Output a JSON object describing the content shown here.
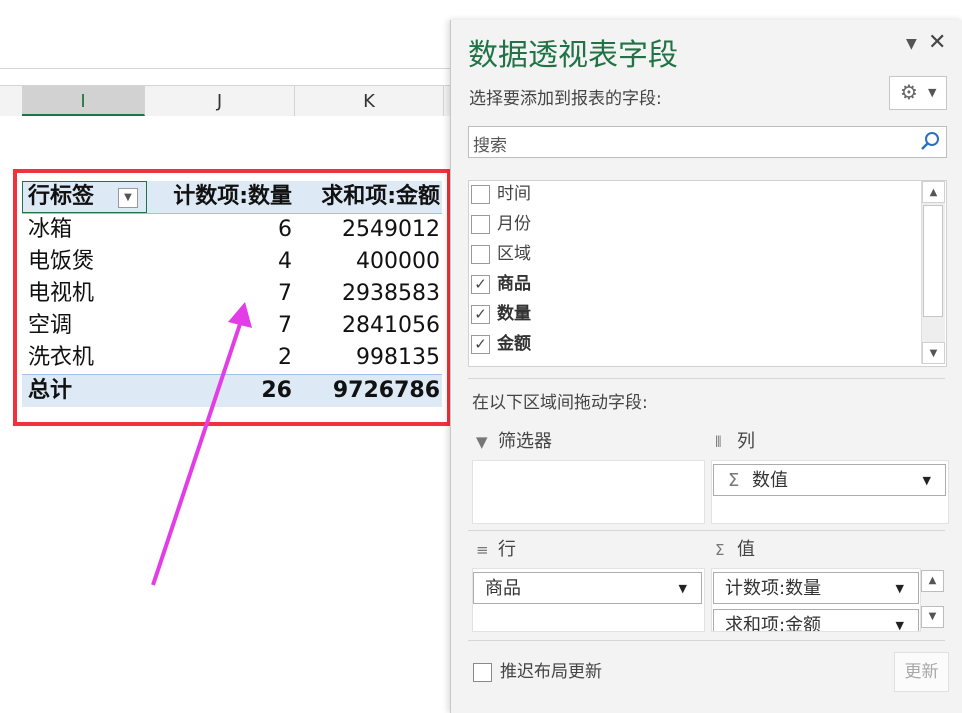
{
  "spreadsheet": {
    "columns": [
      "I",
      "J",
      "K"
    ],
    "pivot": {
      "headers": [
        "行标签",
        "计数项:数量",
        "求和项:金额"
      ],
      "rows": [
        {
          "label": "冰箱",
          "count": "6",
          "sum": "2549012"
        },
        {
          "label": "电饭煲",
          "count": "4",
          "sum": "400000"
        },
        {
          "label": "电视机",
          "count": "7",
          "sum": "2938583"
        },
        {
          "label": "空调",
          "count": "7",
          "sum": "2841056"
        },
        {
          "label": "洗衣机",
          "count": "2",
          "sum": "998135"
        }
      ],
      "total": {
        "label": "总计",
        "count": "26",
        "sum": "9726786"
      }
    }
  },
  "panel": {
    "title": "数据透视表字段",
    "choose_label": "选择要添加到报表的字段:",
    "search_placeholder": "搜索",
    "fields": [
      {
        "label": "时间",
        "checked": false
      },
      {
        "label": "月份",
        "checked": false
      },
      {
        "label": "区域",
        "checked": false
      },
      {
        "label": "商品",
        "checked": true
      },
      {
        "label": "数量",
        "checked": true
      },
      {
        "label": "金额",
        "checked": true
      }
    ],
    "drag_label": "在以下区域间拖动字段:",
    "areas": {
      "filters": "筛选器",
      "columns": "列",
      "rows": "行",
      "values": "值"
    },
    "columns_item": "数值",
    "rows_item": "商品",
    "values_items": [
      "计数项:数量",
      "求和项:金额"
    ],
    "defer_label": "推迟布局更新",
    "update_label": "更新",
    "sigma": "Σ"
  },
  "colors": {
    "accent": "#217346",
    "highlight_box": "#f0333a",
    "arrow": "#e23de6",
    "pivot_header_bg": "#dde9f5"
  }
}
